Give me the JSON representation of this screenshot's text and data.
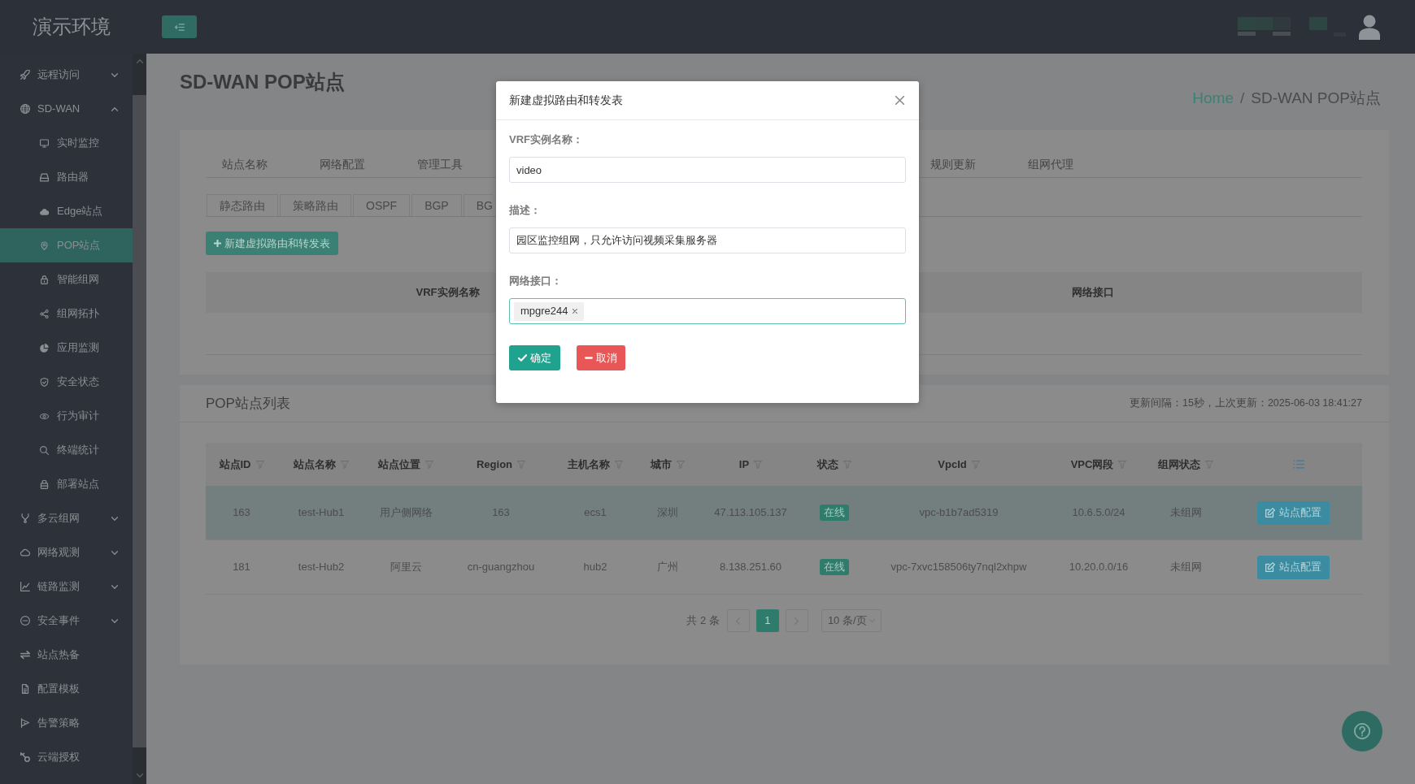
{
  "header": {
    "logo": "演示环境"
  },
  "sidebar": {
    "items": [
      {
        "label": "远程访问",
        "expanded": false,
        "selected": false
      },
      {
        "label": "SD-WAN",
        "expanded": true,
        "selected": false,
        "children": [
          {
            "label": "实时监控",
            "selected": false
          },
          {
            "label": "路由器",
            "selected": false
          },
          {
            "label": "Edge站点",
            "selected": false
          },
          {
            "label": "POP站点",
            "selected": true
          },
          {
            "label": "智能组网",
            "selected": false
          },
          {
            "label": "组网拓扑",
            "selected": false
          },
          {
            "label": "应用监测",
            "selected": false
          },
          {
            "label": "安全状态",
            "selected": false
          },
          {
            "label": "行为审计",
            "selected": false
          },
          {
            "label": "终端统计",
            "selected": false
          },
          {
            "label": "部署站点",
            "selected": false
          }
        ]
      },
      {
        "label": "多云组网",
        "expanded": false,
        "selected": false
      },
      {
        "label": "网络观测",
        "expanded": false,
        "selected": false
      },
      {
        "label": "链路监测",
        "expanded": false,
        "selected": false
      },
      {
        "label": "安全事件",
        "expanded": false,
        "selected": false
      },
      {
        "label": "站点热备",
        "selected": false
      },
      {
        "label": "配置模板",
        "selected": false
      },
      {
        "label": "告警策略",
        "selected": false
      },
      {
        "label": "云端授权",
        "selected": false
      }
    ]
  },
  "page": {
    "title": "SD-WAN POP站点",
    "breadcrumb": {
      "items": [
        {
          "label": "Home",
          "kind": "link"
        },
        {
          "label": "SD-WAN POP站点",
          "kind": "current"
        }
      ],
      "separator": "/"
    }
  },
  "config_panel": {
    "tabs_left": [
      {
        "label": "站点名称",
        "selected": false
      },
      {
        "label": "网络配置",
        "selected": false
      },
      {
        "label": "管理工具",
        "selected": false
      }
    ],
    "tabs_right": [
      {
        "label": "规则更新",
        "selected": false
      },
      {
        "label": "组网代理",
        "selected": false
      }
    ],
    "sub_tabs": [
      {
        "label": "静态路由",
        "selected": false
      },
      {
        "label": "策略路由",
        "selected": false
      },
      {
        "label": "OSPF",
        "selected": false
      },
      {
        "label": "BGP",
        "selected": false
      },
      {
        "label": "BG",
        "selected": false
      }
    ],
    "add_button": "新建虚拟路由和转发表",
    "table": {
      "columns": [
        "VRF实例名称",
        "网络接口"
      ]
    }
  },
  "pop_list": {
    "title": "POP站点列表",
    "refresh_info": "更新间隔：15秒，上次更新：2025-06-03 18:41:27",
    "table": {
      "columns": [
        {
          "label": "站点ID",
          "kind": "text",
          "filterable": true
        },
        {
          "label": "站点名称",
          "kind": "text",
          "filterable": true
        },
        {
          "label": "站点位置",
          "kind": "text",
          "filterable": true
        },
        {
          "label": "Region",
          "kind": "text",
          "filterable": true
        },
        {
          "label": "主机名称",
          "kind": "text",
          "filterable": true
        },
        {
          "label": "城市",
          "kind": "text",
          "filterable": true
        },
        {
          "label": "IP",
          "kind": "text",
          "filterable": true
        },
        {
          "label": "状态",
          "kind": "badge",
          "filterable": true
        },
        {
          "label": "VpcId",
          "kind": "text",
          "filterable": true
        },
        {
          "label": "VPC网段",
          "kind": "text",
          "filterable": true
        },
        {
          "label": "组网状态",
          "kind": "text",
          "filterable": true
        },
        {
          "kind": "actions"
        }
      ],
      "rows": [
        {
          "selected": true,
          "cells": [
            "163",
            "test-Hub1",
            "用户侧网络",
            "163",
            "ecs1",
            "深圳",
            "47.113.105.137",
            "在线",
            "vpc-b1b7ad5319",
            "10.6.5.0/24",
            "未组网",
            "站点配置"
          ]
        },
        {
          "selected": false,
          "cells": [
            "181",
            "test-Hub2",
            "阿里云",
            "cn-guangzhou",
            "hub2",
            "广州",
            "8.138.251.60",
            "在线",
            "vpc-7xvc158506ty7nql2xhpw",
            "10.20.0.0/16",
            "未组网",
            "站点配置"
          ]
        }
      ]
    },
    "pagination": {
      "total": "共 2 条",
      "pages": [
        {
          "label": "1",
          "selected": true
        }
      ],
      "page_size": "10 条/页"
    }
  },
  "dialog": {
    "title": "新建虚拟路由和转发表",
    "fields": [
      {
        "kind": "text",
        "label": "VRF实例名称：",
        "value": "video",
        "focused": false
      },
      {
        "kind": "text",
        "label": "描述：",
        "value": "园区监控组网，只允许访问视频采集服务器",
        "focused": false
      },
      {
        "kind": "tags",
        "label": "网络接口：",
        "tags": [
          "mpgre244"
        ],
        "focused": true
      }
    ],
    "buttons": [
      {
        "kind": "confirm",
        "label": "确定"
      },
      {
        "kind": "cancel",
        "label": "取消"
      }
    ]
  }
}
